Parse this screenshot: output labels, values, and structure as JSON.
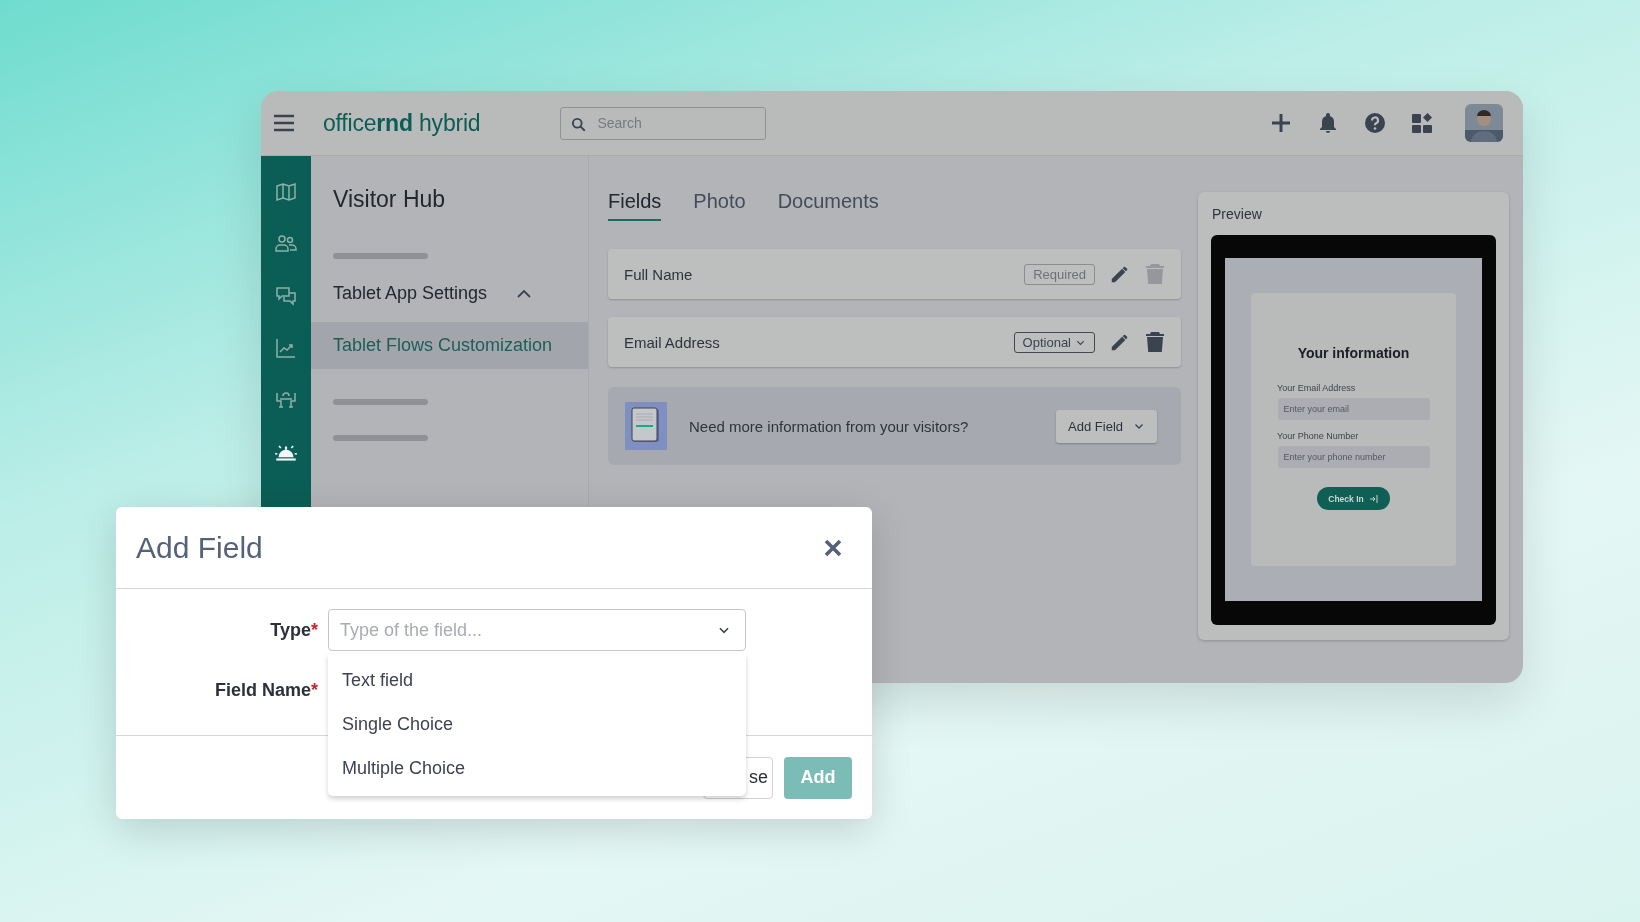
{
  "header": {
    "logo": "office**rnd** hybrid",
    "search": {
      "placeholder": "Search"
    },
    "actions": [
      {
        "kind": "plus"
      },
      {
        "kind": "bell"
      },
      {
        "kind": "help"
      },
      {
        "kind": "apps"
      }
    ]
  },
  "rail": [
    {
      "kind": "map",
      "selected": false
    },
    {
      "kind": "people",
      "selected": false
    },
    {
      "kind": "chat",
      "selected": false
    },
    {
      "kind": "chart",
      "selected": false
    },
    {
      "kind": "desk",
      "selected": false
    },
    {
      "kind": "reception",
      "selected": true
    }
  ],
  "nav": {
    "title": "Visitor Hub",
    "items": [
      {
        "kind": "skeleton"
      },
      {
        "kind": "group",
        "label": "Tablet App Settings",
        "expanded": true
      },
      {
        "kind": "link",
        "label": "Tablet Flows Customization",
        "selected": true
      },
      {
        "kind": "skeleton"
      },
      {
        "kind": "skeleton"
      }
    ]
  },
  "tabs": [
    {
      "label": "Fields",
      "selected": true
    },
    {
      "label": "Photo",
      "selected": false
    },
    {
      "label": "Documents",
      "selected": false
    }
  ],
  "fields": [
    {
      "name": "Full Name",
      "badge": "Required",
      "kind": "fixed",
      "disabled": true
    },
    {
      "name": "Email Address",
      "badge": "Optional",
      "kind": "dropdown",
      "disabled": false
    }
  ],
  "prompt": {
    "text": "Need more information from your visitors?",
    "button": "Add Field"
  },
  "preview": {
    "title": "Preview",
    "form_title": "Your information",
    "inputs": [
      {
        "label": "Your Email Address",
        "placeholder": "Enter your email"
      },
      {
        "label": "Your Phone Number",
        "placeholder": "Enter your phone number"
      }
    ],
    "button": "Check In"
  },
  "modal": {
    "title": "Add Field",
    "fields": [
      {
        "label": "Type",
        "mark": "*"
      },
      {
        "label": "Field Name",
        "mark": "*"
      }
    ],
    "type_placeholder": "Type of the field...",
    "options": [
      "Text field",
      "Single Choice",
      "Multiple Choice"
    ],
    "buttons": [
      {
        "label": "se",
        "kind": "secondary"
      },
      {
        "label": "Add",
        "kind": "primary"
      }
    ]
  }
}
